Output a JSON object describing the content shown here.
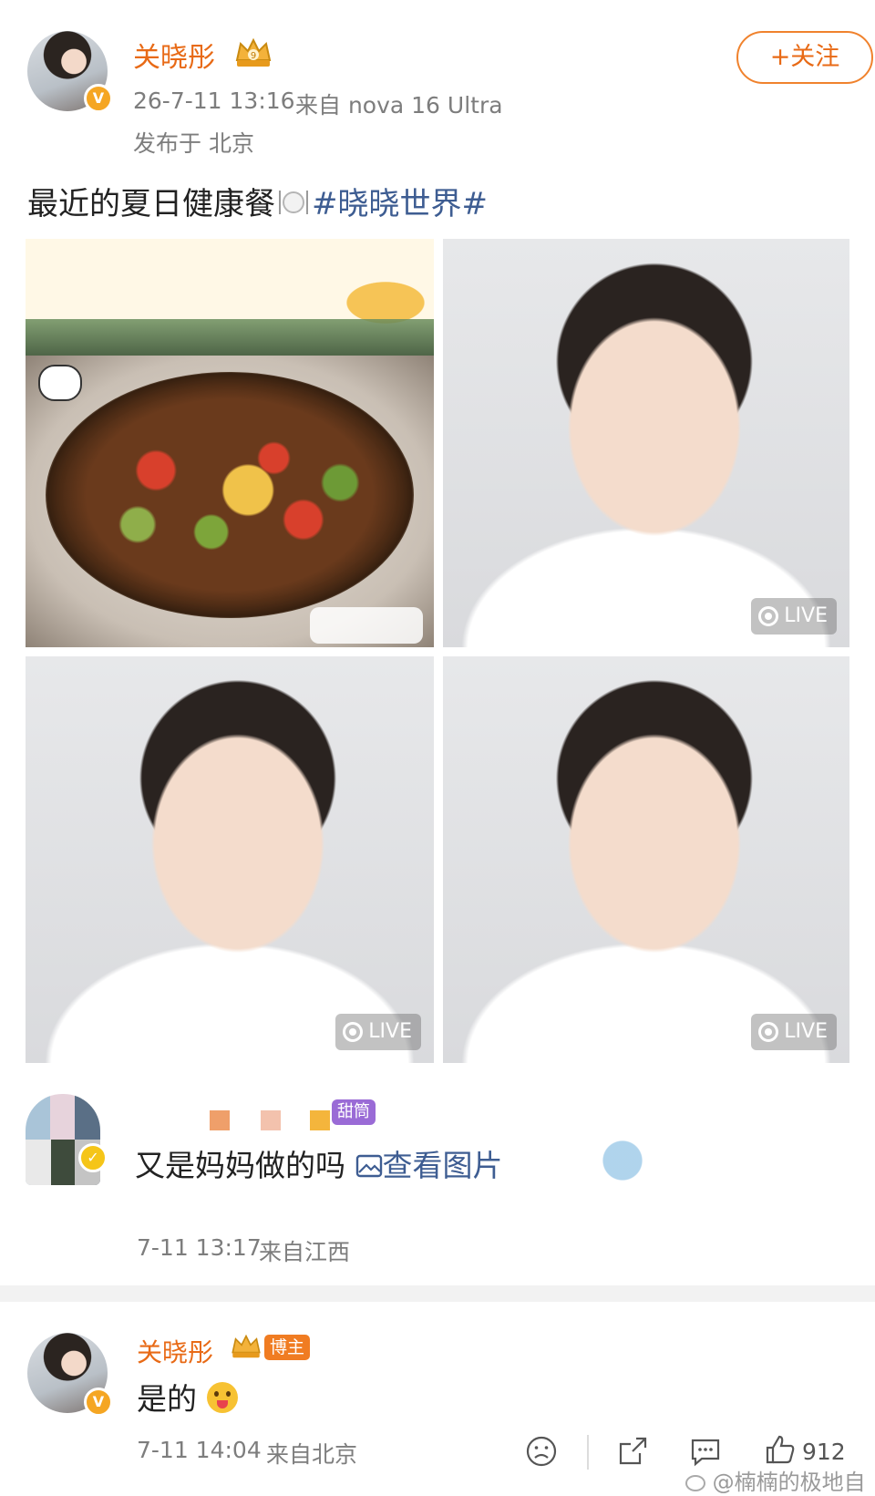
{
  "post": {
    "username": "关晓彤",
    "time": "26-7-11 13:16",
    "source": "来自 nova 16 Ultra",
    "location": "发布于 北京",
    "follow_label": "+关注",
    "text": "最近的夏日健康餐",
    "hashtag": "#晓晓世界#",
    "live_label": "LIVE"
  },
  "comment1": {
    "badge": "甜筒",
    "text": "又是妈妈做的吗",
    "view_image": "查看图片",
    "time": "7-11 13:17",
    "location": "来自江西"
  },
  "reply": {
    "username": "关晓彤",
    "badge": "博主",
    "text": "是的",
    "time": "7-11 14:04",
    "location": "来自北京",
    "like_count": "912"
  },
  "watermark": "@楠楠的极地自",
  "colors": {
    "username": "#e86a16",
    "hashtag": "#3e5d92",
    "meta": "#7d7d7d"
  }
}
